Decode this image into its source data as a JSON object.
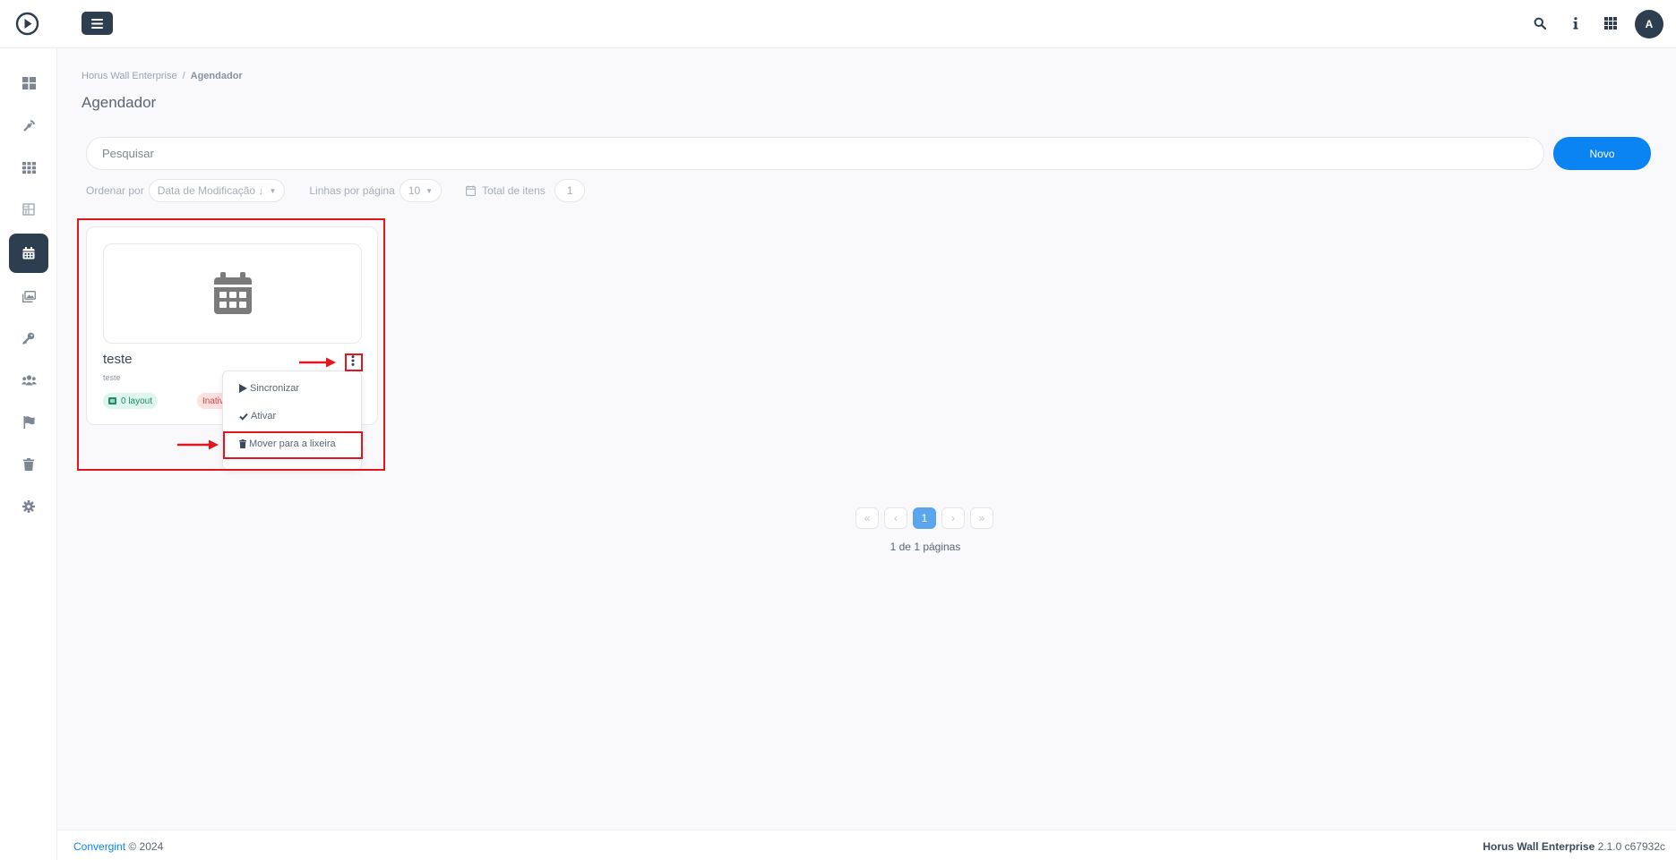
{
  "header": {
    "icons": [
      "search-icon",
      "info-icon",
      "apps-icon"
    ],
    "avatar_letter": "A"
  },
  "sidebar": {
    "items": [
      {
        "icon": "dashboard-icon",
        "active": false
      },
      {
        "icon": "broadcast-icon",
        "active": false
      },
      {
        "icon": "grid-icon",
        "active": false
      },
      {
        "icon": "layout-icon",
        "active": false
      },
      {
        "icon": "calendar-icon",
        "active": true
      },
      {
        "icon": "media-icon",
        "active": false
      },
      {
        "icon": "key-icon",
        "active": false
      },
      {
        "icon": "users-icon",
        "active": false
      },
      {
        "icon": "flag-icon",
        "active": false
      },
      {
        "icon": "trash-icon",
        "active": false
      },
      {
        "icon": "settings-icon",
        "active": false
      }
    ]
  },
  "breadcrumb": {
    "root": "Horus Wall Enterprise",
    "separator": "/",
    "current": "Agendador"
  },
  "page": {
    "title": "Agendador"
  },
  "search": {
    "placeholder": "Pesquisar"
  },
  "actions": {
    "new_label": "Novo"
  },
  "filters": {
    "order_label": "Ordenar por",
    "order_value": "Data de Modificação ↓",
    "rows_label": "Linhas por página",
    "rows_value": "10",
    "total_label": "Total de itens",
    "total_value": "1"
  },
  "card": {
    "title": "teste",
    "subtitle": "teste",
    "layout_badge": "0 layout",
    "status_badge": "Inativo"
  },
  "menu": {
    "sync": "Sincronizar",
    "activate": "Ativar",
    "trash": "Mover para a lixeira"
  },
  "pagination": {
    "current": "1",
    "info": "1 de 1 páginas"
  },
  "footer": {
    "company": "Convergint",
    "copyright": "© 2024",
    "product": "Horus Wall Enterprise",
    "version": "2.1.0 c67932c"
  },
  "colors": {
    "primary": "#0b84f3",
    "dark": "#2d3e50",
    "annotation": "#e4161d"
  }
}
